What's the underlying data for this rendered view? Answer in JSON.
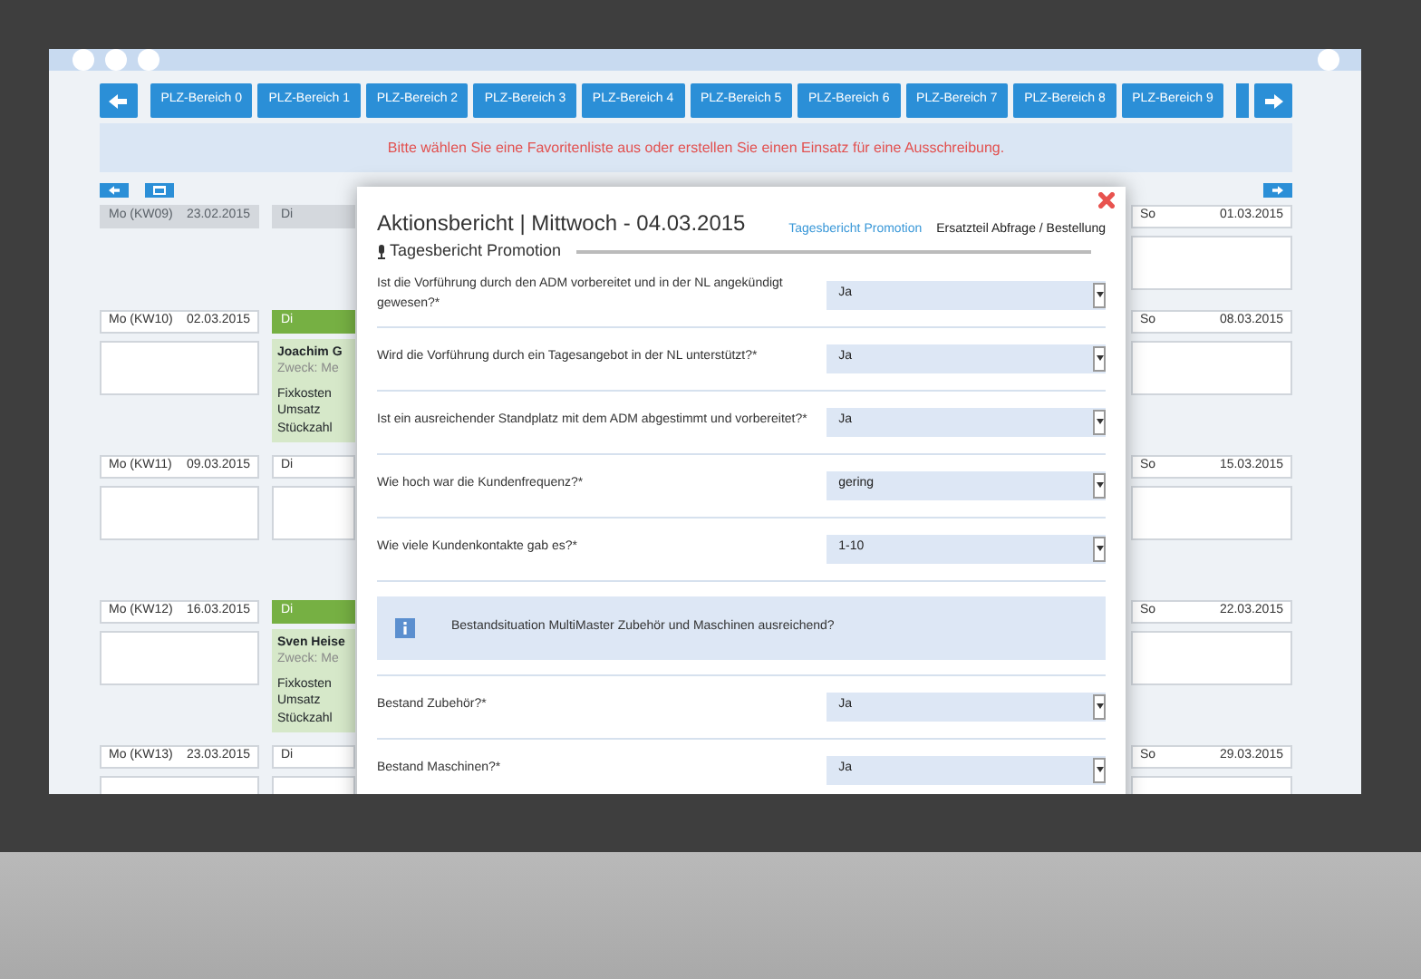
{
  "nav": {
    "tabs": [
      {
        "label": "PLZ-Bereich 0"
      },
      {
        "label": "PLZ-Bereich 1"
      },
      {
        "label": "PLZ-Bereich 2"
      },
      {
        "label": "PLZ-Bereich 3"
      },
      {
        "label": "PLZ-Bereich 4"
      },
      {
        "label": "PLZ-Bereich 5"
      },
      {
        "label": "PLZ-Bereich 6"
      },
      {
        "label": "PLZ-Bereich 7"
      },
      {
        "label": "PLZ-Bereich 8"
      },
      {
        "label": "PLZ-Bereich 9"
      }
    ]
  },
  "notice": "Bitte wählen Sie eine Favoritenliste aus oder erstellen Sie einen Einsatz für eine Ausschreibung.",
  "calendar": {
    "weeks": [
      {
        "past": true,
        "monday": {
          "label": "Mo (KW09)",
          "date": "23.02.2015"
        },
        "tuesday": {
          "label": "Di"
        },
        "sunday": {
          "label": "So",
          "date": "01.03.2015"
        }
      },
      {
        "past": false,
        "monday": {
          "label": "Mo (KW10)",
          "date": "02.03.2015"
        },
        "tuesday": {
          "label": "Di",
          "event": {
            "name": "Joachim G",
            "purpose": "Zweck: Me",
            "lines": [
              "Fixkosten",
              "Umsatz",
              "Stückzahl"
            ]
          }
        },
        "sunday": {
          "label": "So",
          "date": "08.03.2015"
        }
      },
      {
        "past": false,
        "monday": {
          "label": "Mo (KW11)",
          "date": "09.03.2015"
        },
        "tuesday": {
          "label": "Di"
        },
        "sunday": {
          "label": "So",
          "date": "15.03.2015"
        }
      },
      {
        "past": false,
        "monday": {
          "label": "Mo (KW12)",
          "date": "16.03.2015"
        },
        "tuesday": {
          "label": "Di",
          "event": {
            "name": "Sven Heise",
            "purpose": "Zweck: Me",
            "lines": [
              "Fixkosten",
              "Umsatz",
              "Stückzahl"
            ]
          }
        },
        "sunday": {
          "label": "So",
          "date": "22.03.2015"
        }
      },
      {
        "past": false,
        "monday": {
          "label": "Mo (KW13)",
          "date": "23.03.2015"
        },
        "tuesday": {
          "label": "Di"
        },
        "sunday": {
          "label": "So",
          "date": "29.03.2015"
        }
      }
    ]
  },
  "modal": {
    "title": "Aktionsbericht | Mittwoch - 04.03.2015",
    "subtitle": "Tagesbericht Promotion",
    "tabs": [
      {
        "label": "Tagesbericht Promotion",
        "selected": true
      },
      {
        "label": "Ersatzteil Abfrage / Bestellung",
        "selected": false
      }
    ],
    "items": [
      {
        "kind": "question",
        "label": "Ist die Vorführung durch den ADM vorbereitet und in der NL angekündigt gewesen?*",
        "value": "Ja"
      },
      {
        "kind": "question",
        "label": "Wird die Vorführung durch ein Tagesangebot in der NL unterstützt?*",
        "value": "Ja"
      },
      {
        "kind": "question",
        "label": "Ist ein ausreichender Standplatz mit dem ADM abgestimmt und vorbereitet?*",
        "value": "Ja"
      },
      {
        "kind": "question",
        "label": "Wie hoch war die Kundenfrequenz?*",
        "value": "gering"
      },
      {
        "kind": "question",
        "label": "Wie viele Kundenkontakte gab es?*",
        "value": "1-10"
      },
      {
        "kind": "info",
        "text": "Bestandsituation MultiMaster Zubehör und Maschinen ausreichend?"
      },
      {
        "kind": "question",
        "label": "Bestand Zubehör?*",
        "value": "Ja"
      },
      {
        "kind": "question",
        "label": "Bestand Maschinen?*",
        "value": "Ja"
      }
    ]
  }
}
